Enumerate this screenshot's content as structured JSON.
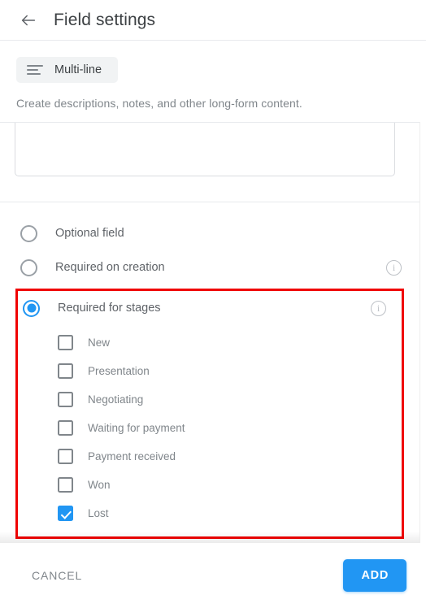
{
  "header": {
    "back_icon": "arrow-left-icon",
    "title": "Field settings"
  },
  "field_type": {
    "icon": "multiline-text-icon",
    "name": "Multi-line",
    "description": "Create descriptions, notes, and other long-form content."
  },
  "textarea": {
    "value": "",
    "placeholder": ""
  },
  "requirement_options": [
    {
      "label": "Optional field",
      "selected": false,
      "has_info": false
    },
    {
      "label": "Required on creation",
      "selected": false,
      "has_info": true
    },
    {
      "label": "Required for stages",
      "selected": true,
      "has_info": true
    }
  ],
  "info_icon_glyph": "i",
  "stages": [
    {
      "label": "New",
      "checked": false
    },
    {
      "label": "Presentation",
      "checked": false
    },
    {
      "label": "Negotiating",
      "checked": false
    },
    {
      "label": "Waiting for payment",
      "checked": false
    },
    {
      "label": "Payment received",
      "checked": false
    },
    {
      "label": "Won",
      "checked": false
    },
    {
      "label": "Lost",
      "checked": true
    }
  ],
  "footer": {
    "cancel_label": "CANCEL",
    "add_label": "ADD"
  },
  "colors": {
    "accent": "#2196f3",
    "highlight": "#f00000",
    "text_primary": "#3c4043",
    "text_secondary": "#5f6368",
    "text_muted": "#80868b",
    "divider": "#e8eaed"
  }
}
